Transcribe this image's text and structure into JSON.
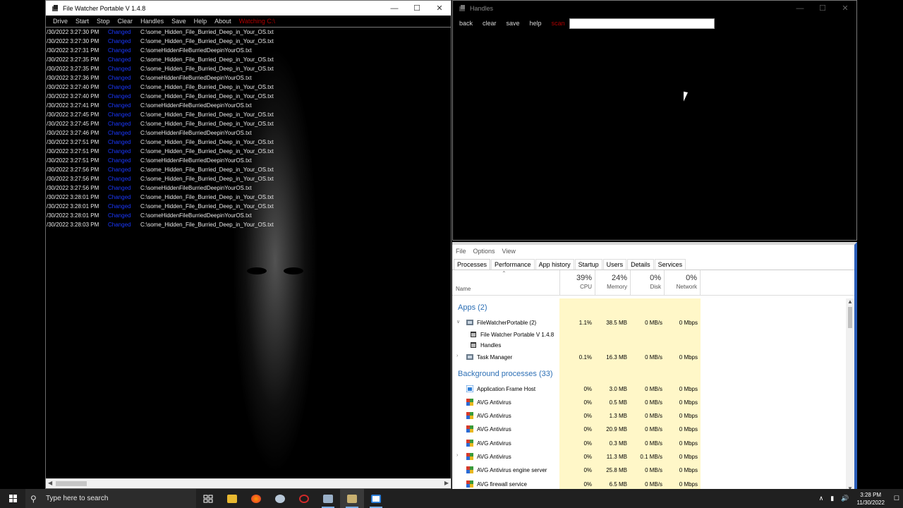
{
  "file_watcher": {
    "title": "File Watcher Portable V 1.4.8",
    "menu": [
      "Drive",
      "Start",
      "Stop",
      "Clear",
      "Handles",
      "Save",
      "Help",
      "About"
    ],
    "status": "Watching C:\\",
    "status_color": "#b00000",
    "event_color": "#1a38ff",
    "log": [
      {
        "time": "/30/2022 3:27:30 PM",
        "event": "Changed",
        "path": "C:\\some_Hidden_File_Burried_Deep_in_Your_OS.txt"
      },
      {
        "time": "/30/2022 3:27:30 PM",
        "event": "Changed",
        "path": "C:\\some_Hidden_File_Burried_Deep_in_Your_OS.txt"
      },
      {
        "time": "/30/2022 3:27:31 PM",
        "event": "Changed",
        "path": "C:\\someHiddenFileBurriedDeepinYourOS.txt"
      },
      {
        "time": "/30/2022 3:27:35 PM",
        "event": "Changed",
        "path": "C:\\some_Hidden_File_Burried_Deep_in_Your_OS.txt"
      },
      {
        "time": "/30/2022 3:27:35 PM",
        "event": "Changed",
        "path": "C:\\some_Hidden_File_Burried_Deep_in_Your_OS.txt"
      },
      {
        "time": "/30/2022 3:27:36 PM",
        "event": "Changed",
        "path": "C:\\someHiddenFileBurriedDeepinYourOS.txt"
      },
      {
        "time": "/30/2022 3:27:40 PM",
        "event": "Changed",
        "path": "C:\\some_Hidden_File_Burried_Deep_in_Your_OS.txt"
      },
      {
        "time": "/30/2022 3:27:40 PM",
        "event": "Changed",
        "path": "C:\\some_Hidden_File_Burried_Deep_in_Your_OS.txt"
      },
      {
        "time": "/30/2022 3:27:41 PM",
        "event": "Changed",
        "path": "C:\\someHiddenFileBurriedDeepinYourOS.txt"
      },
      {
        "time": "/30/2022 3:27:45 PM",
        "event": "Changed",
        "path": "C:\\some_Hidden_File_Burried_Deep_in_Your_OS.txt"
      },
      {
        "time": "/30/2022 3:27:45 PM",
        "event": "Changed",
        "path": "C:\\some_Hidden_File_Burried_Deep_in_Your_OS.txt"
      },
      {
        "time": "/30/2022 3:27:46 PM",
        "event": "Changed",
        "path": "C:\\someHiddenFileBurriedDeepinYourOS.txt"
      },
      {
        "time": "/30/2022 3:27:51 PM",
        "event": "Changed",
        "path": "C:\\some_Hidden_File_Burried_Deep_in_Your_OS.txt"
      },
      {
        "time": "/30/2022 3:27:51 PM",
        "event": "Changed",
        "path": "C:\\some_Hidden_File_Burried_Deep_in_Your_OS.txt"
      },
      {
        "time": "/30/2022 3:27:51 PM",
        "event": "Changed",
        "path": "C:\\someHiddenFileBurriedDeepinYourOS.txt"
      },
      {
        "time": "/30/2022 3:27:56 PM",
        "event": "Changed",
        "path": "C:\\some_Hidden_File_Burried_Deep_in_Your_OS.txt"
      },
      {
        "time": "/30/2022 3:27:56 PM",
        "event": "Changed",
        "path": "C:\\some_Hidden_File_Burried_Deep_in_Your_OS.txt"
      },
      {
        "time": "/30/2022 3:27:56 PM",
        "event": "Changed",
        "path": "C:\\someHiddenFileBurriedDeepinYourOS.txt"
      },
      {
        "time": "/30/2022 3:28:01 PM",
        "event": "Changed",
        "path": "C:\\some_Hidden_File_Burried_Deep_in_Your_OS.txt"
      },
      {
        "time": "/30/2022 3:28:01 PM",
        "event": "Changed",
        "path": "C:\\some_Hidden_File_Burried_Deep_in_Your_OS.txt"
      },
      {
        "time": "/30/2022 3:28:01 PM",
        "event": "Changed",
        "path": "C:\\someHiddenFileBurriedDeepinYourOS.txt"
      },
      {
        "time": "/30/2022 3:28:03 PM",
        "event": "Changed",
        "path": "C:\\some_Hidden_File_Burried_Deep_in_Your_OS.txt"
      }
    ]
  },
  "handles": {
    "title": "Handles",
    "tools": [
      "back",
      "clear",
      "save",
      "help"
    ],
    "scan_label": "scan",
    "search_value": ""
  },
  "task_manager": {
    "menu": [
      "File",
      "Options",
      "View"
    ],
    "tabs": [
      "Processes",
      "Performance",
      "App history",
      "Startup",
      "Users",
      "Details",
      "Services"
    ],
    "active_tab": "Processes",
    "columns": {
      "name": "Name",
      "cpu": {
        "pct": "39%",
        "label": "CPU"
      },
      "memory": {
        "pct": "24%",
        "label": "Memory"
      },
      "disk": {
        "pct": "0%",
        "label": "Disk"
      },
      "network": {
        "pct": "0%",
        "label": "Network"
      }
    },
    "apps_header": "Apps (2)",
    "apps": [
      {
        "name": "FileWatcherPortable (2)",
        "cpu": "1.1%",
        "mem": "38.5 MB",
        "disk": "0 MB/s",
        "net": "0 Mbps",
        "expanded": true,
        "children": [
          "File Watcher Portable V 1.4.8",
          "Handles"
        ]
      },
      {
        "name": "Task Manager",
        "cpu": "0.1%",
        "mem": "16.3 MB",
        "disk": "0 MB/s",
        "net": "0 Mbps",
        "expanded": false,
        "children": []
      }
    ],
    "bg_header": "Background processes (33)",
    "background": [
      {
        "name": "Application Frame Host",
        "cpu": "0%",
        "mem": "3.0 MB",
        "disk": "0 MB/s",
        "net": "0 Mbps",
        "expand": false
      },
      {
        "name": "AVG Antivirus",
        "cpu": "0%",
        "mem": "0.5 MB",
        "disk": "0 MB/s",
        "net": "0 Mbps",
        "expand": false
      },
      {
        "name": "AVG Antivirus",
        "cpu": "0%",
        "mem": "1.3 MB",
        "disk": "0 MB/s",
        "net": "0 Mbps",
        "expand": false
      },
      {
        "name": "AVG Antivirus",
        "cpu": "0%",
        "mem": "20.9 MB",
        "disk": "0 MB/s",
        "net": "0 Mbps",
        "expand": false
      },
      {
        "name": "AVG Antivirus",
        "cpu": "0%",
        "mem": "0.3 MB",
        "disk": "0 MB/s",
        "net": "0 Mbps",
        "expand": false
      },
      {
        "name": "AVG Antivirus",
        "cpu": "0%",
        "mem": "11.3 MB",
        "disk": "0.1 MB/s",
        "net": "0 Mbps",
        "expand": true
      },
      {
        "name": "AVG Antivirus engine server",
        "cpu": "0%",
        "mem": "25.8 MB",
        "disk": "0 MB/s",
        "net": "0 Mbps",
        "expand": false
      },
      {
        "name": "AVG firewall service",
        "cpu": "0%",
        "mem": "6.5 MB",
        "disk": "0 MB/s",
        "net": "0 Mbps",
        "expand": false
      }
    ]
  },
  "taskbar": {
    "search_placeholder": "Type here to search",
    "time": "3:28 PM",
    "date": "11/30/2022",
    "apps": [
      "taskview-icon",
      "file-explorer-icon",
      "firefox-icon",
      "app-icon",
      "app-icon",
      "task-manager-icon",
      "file-watcher-icon",
      "handles-icon"
    ]
  },
  "colors": {
    "heat": "#fff7c8",
    "accent_blue": "#2c6fb5"
  }
}
